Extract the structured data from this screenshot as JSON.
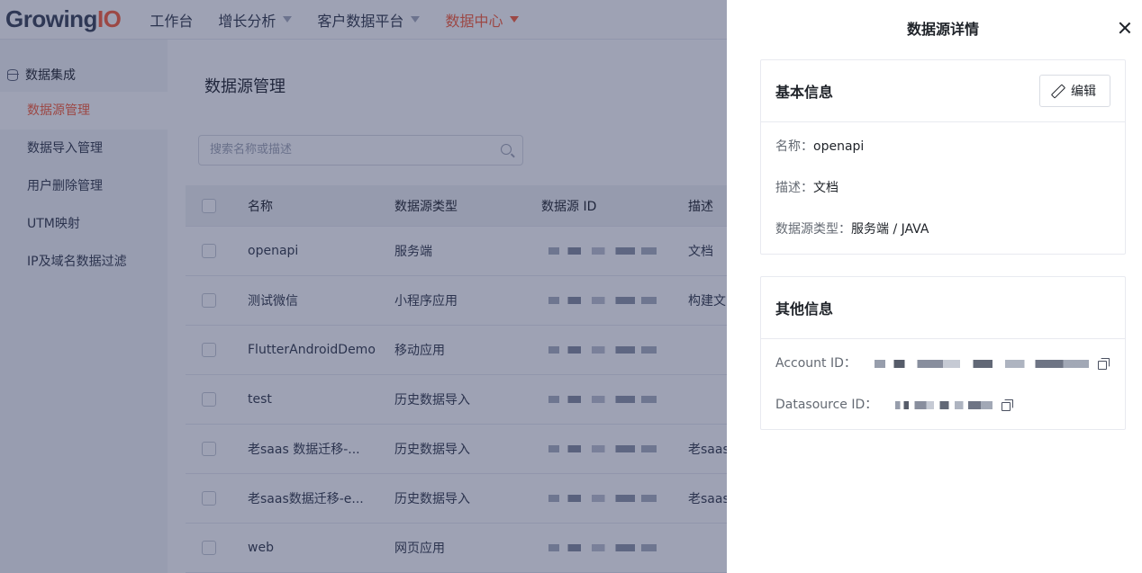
{
  "app": {
    "logo_main": "Growing",
    "logo_io": "IO"
  },
  "nav": [
    {
      "label": "工作台"
    },
    {
      "label": "增长分析"
    },
    {
      "label": "客户数据平台"
    },
    {
      "label": "数据中心"
    }
  ],
  "sidebar": {
    "group_label": "数据集成",
    "items": [
      {
        "label": "数据源管理"
      },
      {
        "label": "数据导入管理"
      },
      {
        "label": "用户删除管理"
      },
      {
        "label": "UTM映射"
      },
      {
        "label": "IP及域名数据过滤"
      }
    ]
  },
  "main": {
    "title": "数据源管理",
    "search_placeholder": "搜索名称或描述"
  },
  "table": {
    "headers": {
      "name": "名称",
      "type": "数据源类型",
      "id": "数据源 ID",
      "desc": "描述"
    },
    "rows": [
      {
        "name": "openapi",
        "type": "服务端",
        "desc": "文档"
      },
      {
        "name": "测试微信",
        "type": "小程序应用",
        "desc": "构建文"
      },
      {
        "name": "FlutterAndroidDemo",
        "type": "移动应用",
        "desc": ""
      },
      {
        "name": "test",
        "type": "历史数据导入",
        "desc": ""
      },
      {
        "name": "老saas 数据迁移-...",
        "type": "历史数据导入",
        "desc": "老saas"
      },
      {
        "name": "老saas数据迁移-e...",
        "type": "历史数据导入",
        "desc": "老saas"
      },
      {
        "name": "web",
        "type": "网页应用",
        "desc": ""
      }
    ]
  },
  "drawer": {
    "title": "数据源详情",
    "basic": {
      "title": "基本信息",
      "edit_label": "编辑",
      "name_label": "名称：",
      "name_value": "openapi",
      "desc_label": "描述：",
      "desc_value": "文档",
      "type_label": "数据源类型：",
      "type_value": "服务端 / JAVA"
    },
    "other": {
      "title": "其他信息",
      "account_label": "Account ID：",
      "datasource_label": "Datasource ID："
    }
  },
  "colors": {
    "accent": "#fc5f3a",
    "overlay": "rgba(34,44,84,0.44)"
  }
}
